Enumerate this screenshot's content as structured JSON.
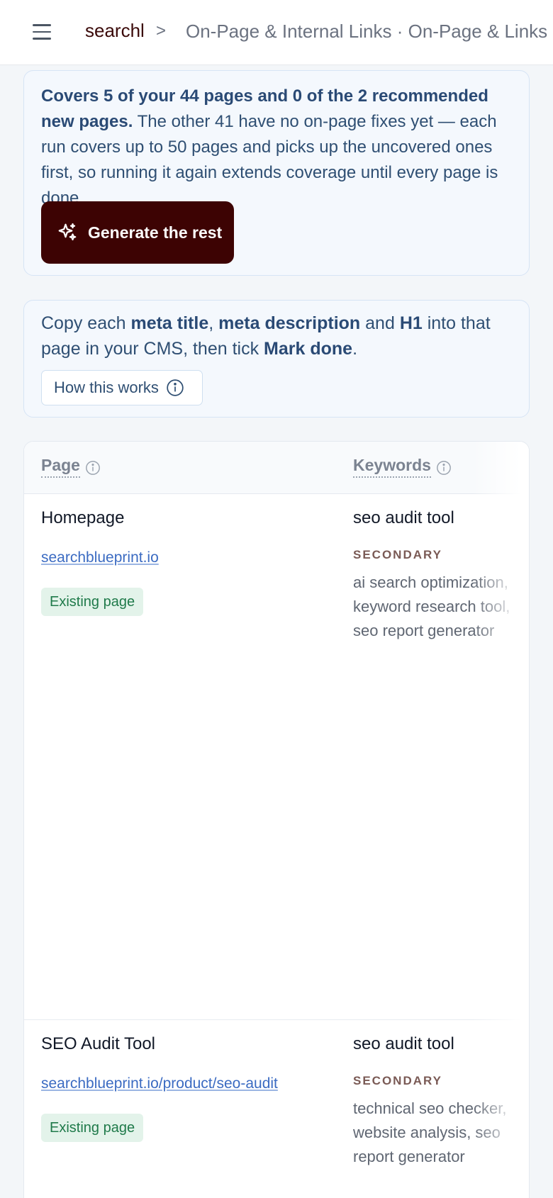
{
  "header": {
    "brand": "searchl",
    "separator": ">",
    "breadcrumb": "On-Page & Internal Links · On-Page & Links"
  },
  "coverage": {
    "bold": "Covers 5 of your 44 pages and 0 of the 2 recommended new pages.",
    "rest": " The other 41 have no on-page fixes yet — each run covers up to 50 pages and picks up the uncovered ones first, so running it again extends coverage until every page is done.",
    "button_label": "Generate the rest"
  },
  "instructions": {
    "t1": "Copy each ",
    "b1": "meta title",
    "t2": ", ",
    "b2": "meta description",
    "t3": " and ",
    "b3": "H1",
    "t4": " into that page in your CMS, then tick ",
    "b4": "Mark done",
    "t5": ".",
    "how_label": "How this works"
  },
  "table": {
    "columns": [
      "Page",
      "Keywords"
    ],
    "secondary_label": "SECONDARY",
    "rows": [
      {
        "page": "Homepage",
        "url": "searchblueprint.io",
        "status": "Existing page",
        "primary_keyword": "seo audit tool",
        "secondary_keywords": "ai search optimization, keyword research tool, seo report generator"
      },
      {
        "page": "SEO Audit Tool",
        "url": "searchblueprint.io/product/seo-audit",
        "status": "Existing page",
        "primary_keyword": "seo audit tool",
        "secondary_keywords": "technical seo checker, website analysis, seo report generator"
      }
    ]
  },
  "colors": {
    "primary_button": "#3d0303",
    "accent_text": "#2f4f73",
    "link": "#3b6bc2",
    "badge_bg": "#e3f3ea",
    "badge_text": "#1f7a4a"
  }
}
